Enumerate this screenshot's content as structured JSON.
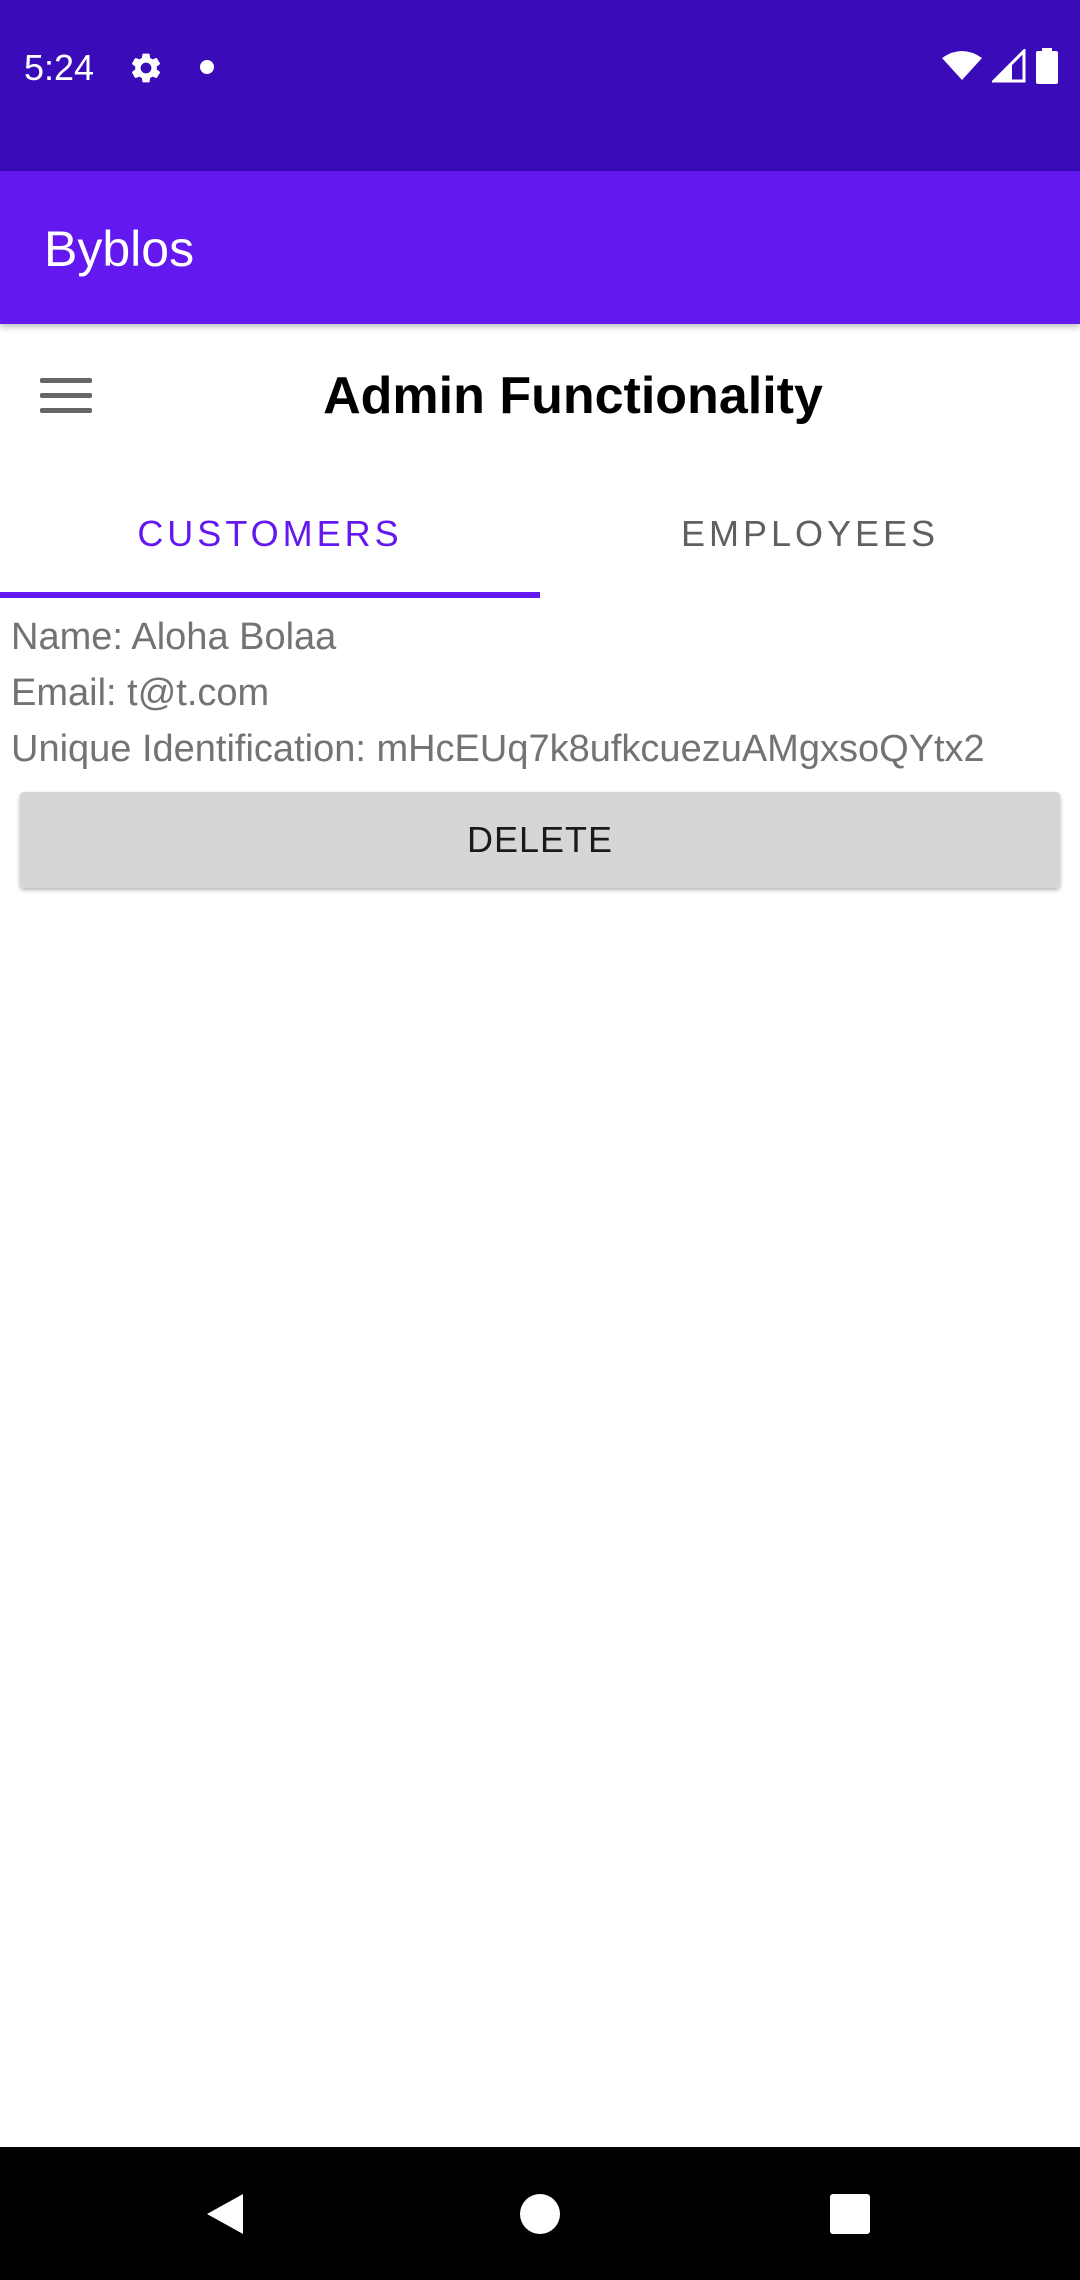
{
  "status_bar": {
    "time": "5:24",
    "icons": [
      "settings-gear-icon",
      "notification-dot-icon",
      "wifi-icon",
      "cell-signal-icon",
      "battery-icon"
    ]
  },
  "app_bar": {
    "title": "Byblos",
    "color": "#6318f0"
  },
  "header": {
    "menu_icon": "hamburger-menu-icon",
    "title": "Admin Functionality"
  },
  "tabs": [
    {
      "label": "CUSTOMERS",
      "selected": true
    },
    {
      "label": "EMPLOYEES",
      "selected": false
    }
  ],
  "customer": {
    "name": "Name: Aloha Bolaa",
    "email": "Email: t@t.com",
    "uid": "Unique Identification: mHcEUq7k8ufkcuezuAMgxsoQYtx2",
    "delete_label": "DELETE"
  },
  "nav_bar": {
    "icons": [
      "back-icon",
      "home-icon",
      "recents-icon"
    ]
  }
}
